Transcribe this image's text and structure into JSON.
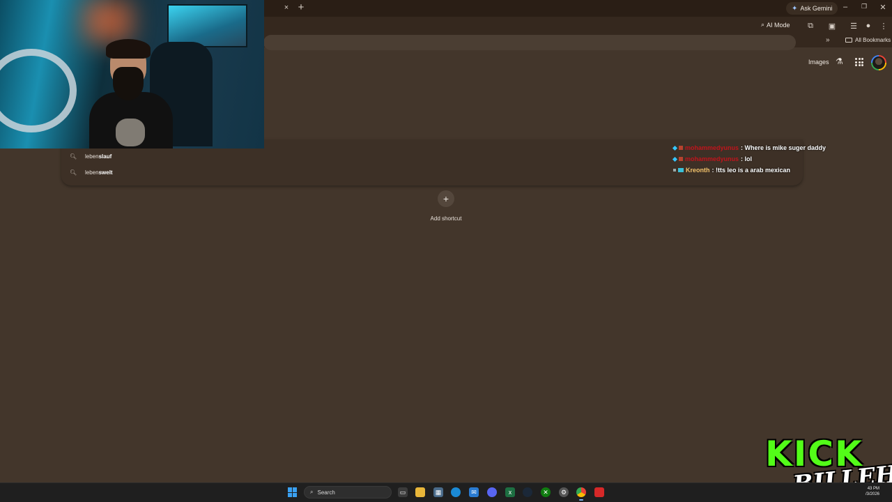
{
  "browser": {
    "tab_close_glyph": "×",
    "new_tab_glyph": "+",
    "ask_gemini": "Ask Gemini",
    "ai_mode": "AI Mode",
    "all_bookmarks": "All Bookmarks",
    "bookmarks_more_glyph": "»",
    "window_controls": {
      "minimize": "–",
      "restore": "❐",
      "close": "✕"
    }
  },
  "page": {
    "images_link": "Images",
    "add_shortcut_glyph": "+",
    "add_shortcut_label": "Add shortcut"
  },
  "suggestions": [
    {
      "prefix": "leben",
      "completion": "slauf"
    },
    {
      "prefix": "leben",
      "completion": "swelt"
    }
  ],
  "chat": [
    {
      "user": "mohammedyunus",
      "user_color": "#c0141c",
      "text": ": Where is mike suger daddy"
    },
    {
      "user": "mohammedyunus",
      "user_color": "#c0141c",
      "text": ": lol"
    },
    {
      "user": "Kreonth",
      "user_color": "#f2c26b",
      "text": ": !tts leo is a arab mexican"
    }
  ],
  "taskbar": {
    "search_label": "Search",
    "time": "43 PM",
    "date": "/3/2026"
  },
  "overlay": {
    "logo_top": "KICK",
    "logo_bottom": "BILLEH"
  },
  "colors": {
    "page_bg": "#43362b",
    "kick_green": "#53fc18"
  }
}
